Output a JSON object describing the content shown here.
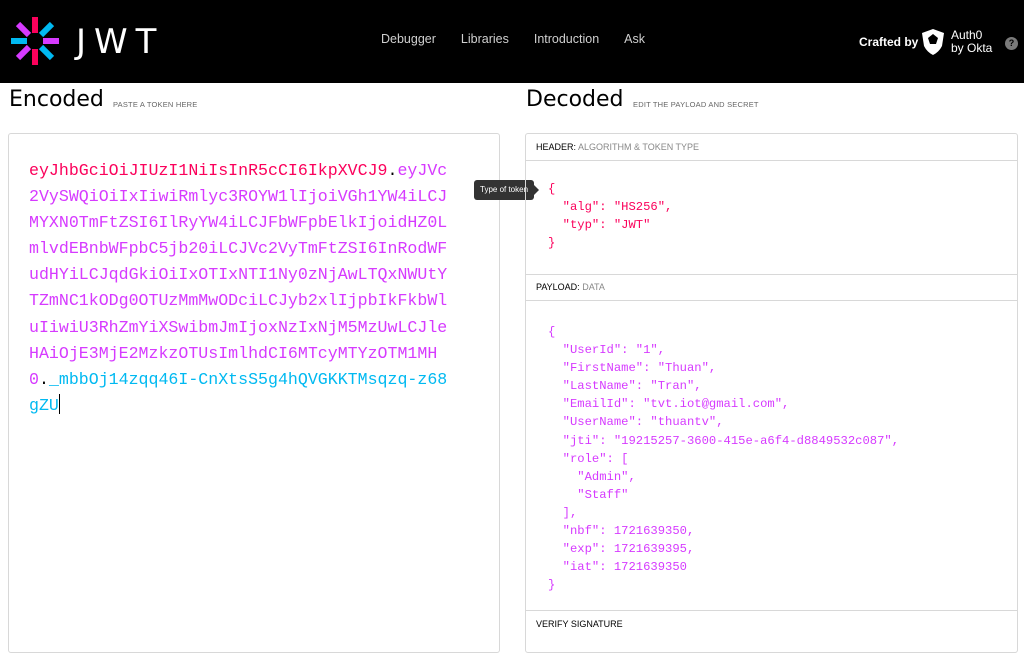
{
  "nav": {
    "logo_text": "JWT",
    "links": [
      "Debugger",
      "Libraries",
      "Introduction",
      "Ask"
    ],
    "crafted_by": "Crafted by",
    "partner": "Auth0",
    "partner_sub": "by Okta",
    "help": "?"
  },
  "encoded": {
    "title": "Encoded",
    "subtitle": "PASTE A TOKEN HERE",
    "token_header": "eyJhbGciOiJIUzI1NiIsInR5cCI6IkpXVCJ9",
    "token_payload": "eyJVc2VySWQiOiIxIiwiRmlyc3ROYW1lIjoiVGh1YW4iLCJMYXN0TmFtZSI6IlRyYW4iLCJFbWFpbElkIjoidHZ0LmlvdEBnbWFpbC5jb20iLCJVc2VyTmFtZSI6InRodWFudHYiLCJqdGkiOiIxOTIxNTI1Ny0zNjAwLTQxNWUtYTZmNC1kODg0OTUzMmMwODciLCJyb2xlIjpbIkFkbWluIiwiU3RhZmYiXSwibmJmIjoxNzIxNjM5MzUwLCJleHAiOjE3MjE2MzkzOTUsImlhdCI6MTcyMTYzOTM1MH0",
    "token_signature": "_mbbOj14zqq46I-CnXtsS5g4hQVGKKTMsqzq-z68gZU",
    "dot": "."
  },
  "tooltip": "Type of token",
  "decoded": {
    "title": "Decoded",
    "subtitle": "EDIT THE PAYLOAD AND SECRET",
    "header_label": "HEADER:",
    "header_sub": "ALGORITHM & TOKEN TYPE",
    "header_json": "{\n  \"alg\": \"HS256\",\n  \"typ\": \"JWT\"\n}",
    "payload_label": "PAYLOAD:",
    "payload_sub": "DATA",
    "payload_json": "{\n  \"UserId\": \"1\",\n  \"FirstName\": \"Thuan\",\n  \"LastName\": \"Tran\",\n  \"EmailId\": \"tvt.iot@gmail.com\",\n  \"UserName\": \"thuantv\",\n  \"jti\": \"19215257-3600-415e-a6f4-d8849532c087\",\n  \"role\": [\n    \"Admin\",\n    \"Staff\"\n  ],\n  \"nbf\": 1721639350,\n  \"exp\": 1721639395,\n  \"iat\": 1721639350\n}",
    "verify_label": "VERIFY SIGNATURE"
  },
  "colors": {
    "header": "#fb015b",
    "payload": "#d63aff",
    "signature": "#00b9f1"
  }
}
